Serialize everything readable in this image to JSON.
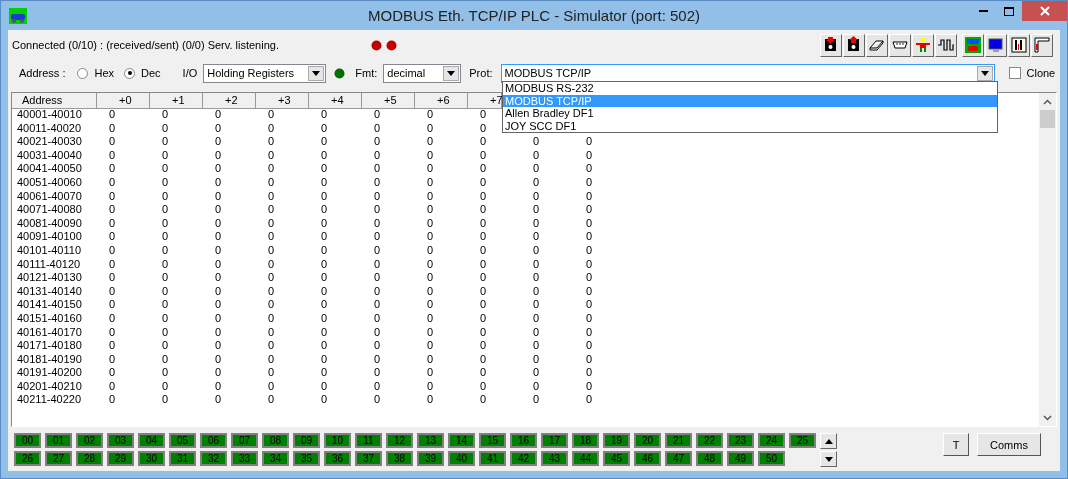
{
  "window": {
    "title": "MODBUS Eth. TCP/IP PLC - Simulator (port: 502)"
  },
  "status": {
    "text": "Connected (0/10) : (received/sent) (0/0) Serv. listening."
  },
  "address": {
    "label": "Address :",
    "options": [
      {
        "label": "Hex",
        "selected": false
      },
      {
        "label": "Dec",
        "selected": true
      }
    ]
  },
  "io": {
    "label": "I/O",
    "value": "Holding Registers"
  },
  "fmt": {
    "label": "Fmt:",
    "value": "decimal"
  },
  "prot": {
    "label": "Prot:",
    "value": "MODBUS TCP/IP",
    "expanded": true,
    "options": [
      {
        "label": "MODBUS RS-232",
        "selected": false
      },
      {
        "label": "MODBUS TCP/IP",
        "selected": true
      },
      {
        "label": "Allen Bradley DF1",
        "selected": false
      },
      {
        "label": "JOY SCC DF1",
        "selected": false
      }
    ]
  },
  "clone": {
    "label": "Clone",
    "checked": false
  },
  "table": {
    "columns": [
      "Address",
      "+0",
      "+1",
      "+2",
      "+3",
      "+4",
      "+5",
      "+6",
      "+7"
    ],
    "rows": [
      {
        "address": "40001-40010",
        "values": [
          "0",
          "0",
          "0",
          "0",
          "0",
          "0",
          "0",
          "0"
        ]
      },
      {
        "address": "40011-40020",
        "values": [
          "0",
          "0",
          "0",
          "0",
          "0",
          "0",
          "0",
          "0"
        ]
      },
      {
        "address": "40021-40030",
        "values": [
          "0",
          "0",
          "0",
          "0",
          "0",
          "0",
          "0",
          "0",
          "0",
          "0"
        ]
      },
      {
        "address": "40031-40040",
        "values": [
          "0",
          "0",
          "0",
          "0",
          "0",
          "0",
          "0",
          "0",
          "0",
          "0"
        ]
      },
      {
        "address": "40041-40050",
        "values": [
          "0",
          "0",
          "0",
          "0",
          "0",
          "0",
          "0",
          "0",
          "0",
          "0"
        ]
      },
      {
        "address": "40051-40060",
        "values": [
          "0",
          "0",
          "0",
          "0",
          "0",
          "0",
          "0",
          "0",
          "0",
          "0"
        ]
      },
      {
        "address": "40061-40070",
        "values": [
          "0",
          "0",
          "0",
          "0",
          "0",
          "0",
          "0",
          "0",
          "0",
          "0"
        ]
      },
      {
        "address": "40071-40080",
        "values": [
          "0",
          "0",
          "0",
          "0",
          "0",
          "0",
          "0",
          "0",
          "0",
          "0"
        ]
      },
      {
        "address": "40081-40090",
        "values": [
          "0",
          "0",
          "0",
          "0",
          "0",
          "0",
          "0",
          "0",
          "0",
          "0"
        ]
      },
      {
        "address": "40091-40100",
        "values": [
          "0",
          "0",
          "0",
          "0",
          "0",
          "0",
          "0",
          "0",
          "0",
          "0"
        ]
      },
      {
        "address": "40101-40110",
        "values": [
          "0",
          "0",
          "0",
          "0",
          "0",
          "0",
          "0",
          "0",
          "0",
          "0"
        ]
      },
      {
        "address": "40111-40120",
        "values": [
          "0",
          "0",
          "0",
          "0",
          "0",
          "0",
          "0",
          "0",
          "0",
          "0"
        ]
      },
      {
        "address": "40121-40130",
        "values": [
          "0",
          "0",
          "0",
          "0",
          "0",
          "0",
          "0",
          "0",
          "0",
          "0"
        ]
      },
      {
        "address": "40131-40140",
        "values": [
          "0",
          "0",
          "0",
          "0",
          "0",
          "0",
          "0",
          "0",
          "0",
          "0"
        ]
      },
      {
        "address": "40141-40150",
        "values": [
          "0",
          "0",
          "0",
          "0",
          "0",
          "0",
          "0",
          "0",
          "0",
          "0"
        ]
      },
      {
        "address": "40151-40160",
        "values": [
          "0",
          "0",
          "0",
          "0",
          "0",
          "0",
          "0",
          "0",
          "0",
          "0"
        ]
      },
      {
        "address": "40161-40170",
        "values": [
          "0",
          "0",
          "0",
          "0",
          "0",
          "0",
          "0",
          "0",
          "0",
          "0"
        ]
      },
      {
        "address": "40171-40180",
        "values": [
          "0",
          "0",
          "0",
          "0",
          "0",
          "0",
          "0",
          "0",
          "0",
          "0"
        ]
      },
      {
        "address": "40181-40190",
        "values": [
          "0",
          "0",
          "0",
          "0",
          "0",
          "0",
          "0",
          "0",
          "0",
          "0"
        ]
      },
      {
        "address": "40191-40200",
        "values": [
          "0",
          "0",
          "0",
          "0",
          "0",
          "0",
          "0",
          "0",
          "0",
          "0"
        ]
      },
      {
        "address": "40201-40210",
        "values": [
          "0",
          "0",
          "0",
          "0",
          "0",
          "0",
          "0",
          "0",
          "0",
          "0"
        ]
      },
      {
        "address": "40211-40220",
        "values": [
          "0",
          "0",
          "0",
          "0",
          "0",
          "0",
          "0",
          "0",
          "0",
          "0"
        ]
      }
    ]
  },
  "stations": [
    [
      "00",
      "01",
      "02",
      "03",
      "04",
      "05",
      "06",
      "07",
      "08",
      "09",
      "10",
      "11",
      "12",
      "13",
      "14",
      "15",
      "16",
      "17",
      "18",
      "19",
      "20",
      "21",
      "22",
      "23",
      "24",
      "25"
    ],
    [
      "26",
      "27",
      "28",
      "29",
      "30",
      "31",
      "32",
      "33",
      "34",
      "35",
      "36",
      "37",
      "38",
      "39",
      "40",
      "41",
      "42",
      "43",
      "44",
      "45",
      "46",
      "47",
      "48",
      "49",
      "50"
    ]
  ],
  "buttons": [
    "T",
    "Comms"
  ]
}
